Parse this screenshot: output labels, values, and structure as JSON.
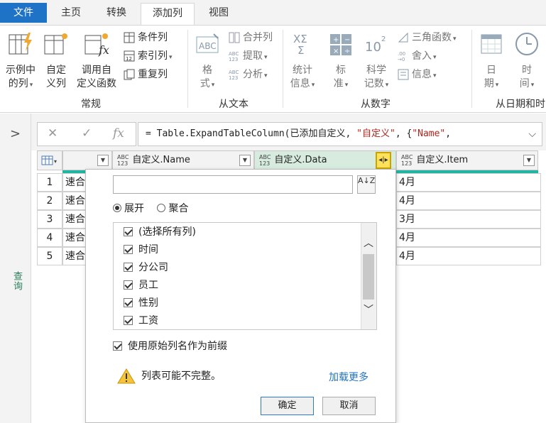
{
  "tabs": [
    "文件",
    "主页",
    "转换",
    "添加列",
    "视图"
  ],
  "ribbon": {
    "general": {
      "label": "常规",
      "example_column": [
        "示例中",
        "的列"
      ],
      "custom_column": [
        "自定",
        "义列"
      ],
      "invoke_function": [
        "调用自",
        "定义函数"
      ],
      "conditional_column": "条件列",
      "index_column": "索引列",
      "duplicate_column": "重复列"
    },
    "from_text": {
      "label": "从文本",
      "format": [
        "格",
        "式"
      ],
      "merge_columns": "合并列",
      "extract": "提取",
      "parse": "分析"
    },
    "from_number": {
      "label": "从数字",
      "statistics": [
        "统计",
        "信息"
      ],
      "standard": [
        "标",
        "准"
      ],
      "scientific": [
        "科学",
        "记数"
      ],
      "trigonometry": "三角函数",
      "rounding": "舍入",
      "information": "信息"
    },
    "from_datetime": {
      "label": "从日期和时间",
      "date": [
        "日",
        "期"
      ],
      "time": [
        "时",
        "间"
      ]
    }
  },
  "nav": {
    "queries_label": "查询"
  },
  "formula_bar": {
    "formula_prefix": "= Table.ExpandTableColumn(已添加自定义, ",
    "formula_str1": "\"自定义\"",
    "formula_mid": ", {",
    "formula_str2": "\"Name\"",
    "formula_end": ","
  },
  "grid": {
    "type_badge_top": "ABC",
    "type_badge_bottom": "123",
    "columns": [
      "自定义.Name",
      "自定义.Data",
      "自定义.Item"
    ],
    "row_numbers": [
      "1",
      "2",
      "3",
      "4",
      "5"
    ],
    "name_values": [
      "速合",
      "速合",
      "速合",
      "速合",
      "速合"
    ],
    "item_values": [
      "4月",
      "4月",
      "3月",
      "4月",
      "4月"
    ]
  },
  "expand_popup": {
    "search_value": "",
    "sort_icon_label": "A↓Z",
    "expand_label": "展开",
    "aggregate_label": "聚合",
    "items": [
      "(选择所有列)",
      "时间",
      "分公司",
      "员工",
      "性别",
      "工资"
    ],
    "prefix_label": "使用原始列名作为前缀",
    "warning_text": "列表可能不完整。",
    "load_more_label": "加载更多",
    "ok_label": "确定",
    "cancel_label": "取消"
  },
  "colors": {
    "file_tab": "#1f73c6",
    "selected_header": "#d7ecdf",
    "header_accent": "#21b5a2",
    "highlight_button": "#ffe15c",
    "arrow": "#e02020",
    "link": "#1f73c6"
  }
}
